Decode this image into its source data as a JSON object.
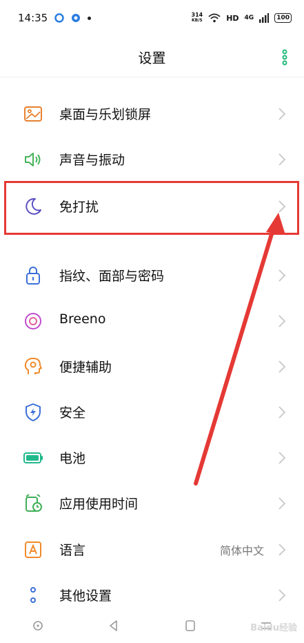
{
  "status": {
    "time": "14:35",
    "speed_value": "314",
    "speed_unit": "KB/S",
    "hd": "HD",
    "network": "4G",
    "battery": "100"
  },
  "header": {
    "title": "设置"
  },
  "items": [
    {
      "label": "桌面与乐划锁屏",
      "icon": "wallpaper-icon",
      "color": "#e8802f"
    },
    {
      "label": "声音与振动",
      "icon": "speaker-icon",
      "color": "#45b35a"
    },
    {
      "label": "免打扰",
      "icon": "moon-icon",
      "color": "#5a4fc3"
    },
    {
      "label": "指纹、面部与密码",
      "icon": "lock-icon",
      "color": "#3b6fd9"
    },
    {
      "label": "Breeno",
      "icon": "breeno-icon",
      "color": "#c04bd0"
    },
    {
      "label": "便捷辅助",
      "icon": "assist-icon",
      "color": "#f08a2a"
    },
    {
      "label": "安全",
      "icon": "shield-icon",
      "color": "#3b6fd9"
    },
    {
      "label": "电池",
      "icon": "battery-icon",
      "color": "#22b98a"
    },
    {
      "label": "应用使用时间",
      "icon": "app-time-icon",
      "color": "#3fae57"
    },
    {
      "label": "语言",
      "icon": "language-icon",
      "color": "#f08a2a",
      "value": "简体中文"
    },
    {
      "label": "其他设置",
      "icon": "more-settings-icon",
      "color": "#3b6fd9"
    }
  ],
  "watermark": "Baidu经验",
  "colors": {
    "accent": "#22b97a",
    "highlight": "#e53935",
    "chevron": "#c7c7c7"
  }
}
